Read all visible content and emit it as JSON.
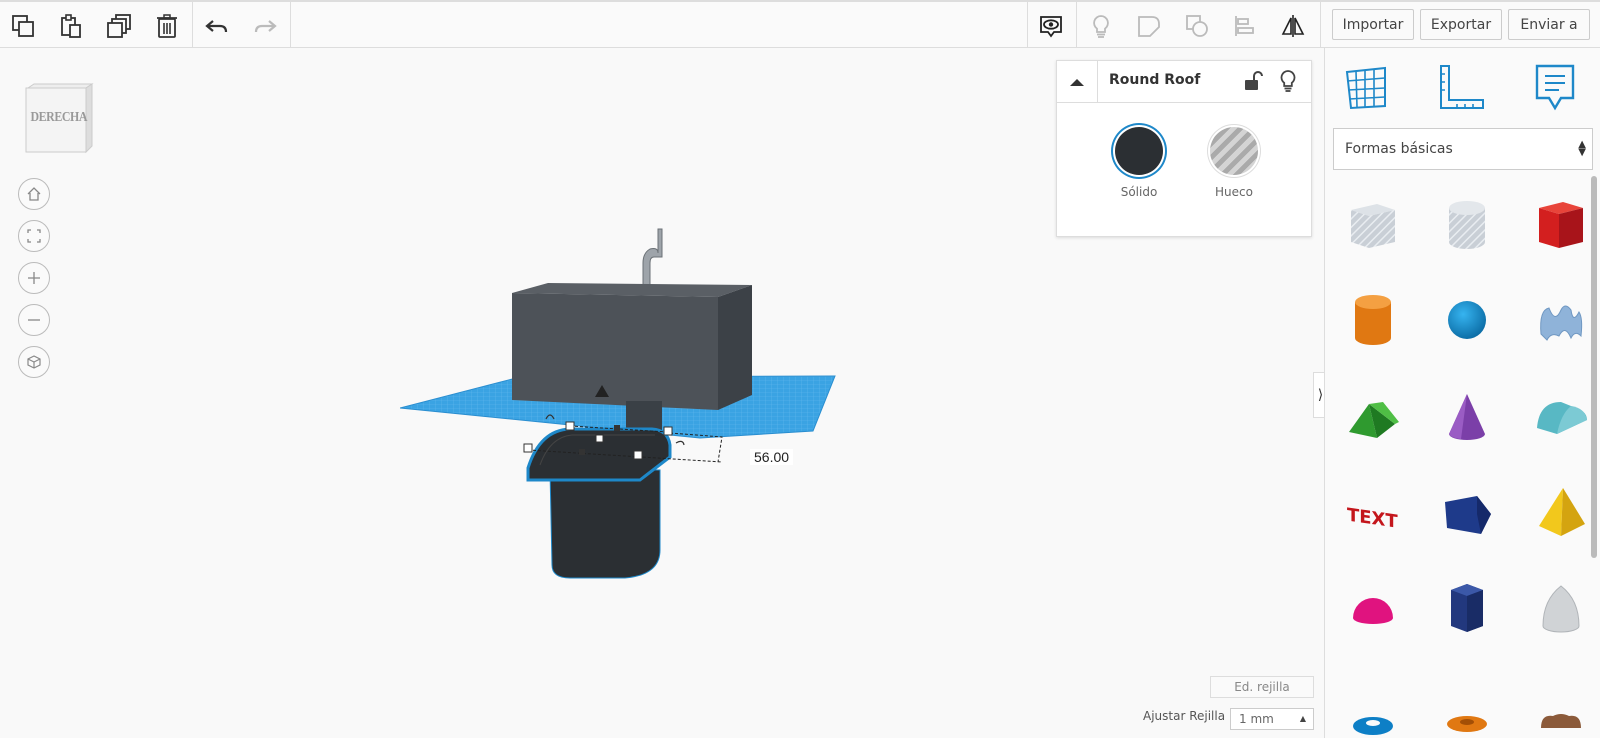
{
  "toolbar": {
    "importar": "Importar",
    "exportar": "Exportar",
    "enviar": "Enviar a"
  },
  "viewcube": {
    "label": "DERECHA"
  },
  "inspector": {
    "title": "Round Roof",
    "solid_label": "Sólido",
    "hole_label": "Hueco",
    "solid_color": "#2b2f33"
  },
  "dimension": {
    "value": "56.00"
  },
  "shapes_panel": {
    "category": "Formas básicas"
  },
  "grid": {
    "edit_label": "Ed. rejilla",
    "snap_label": "Ajustar Rejilla",
    "snap_value": "1 mm"
  },
  "colors": {
    "accent": "#1e88c9",
    "workplane": "#3aa3e3",
    "shape_dark": "#2b2f33"
  }
}
